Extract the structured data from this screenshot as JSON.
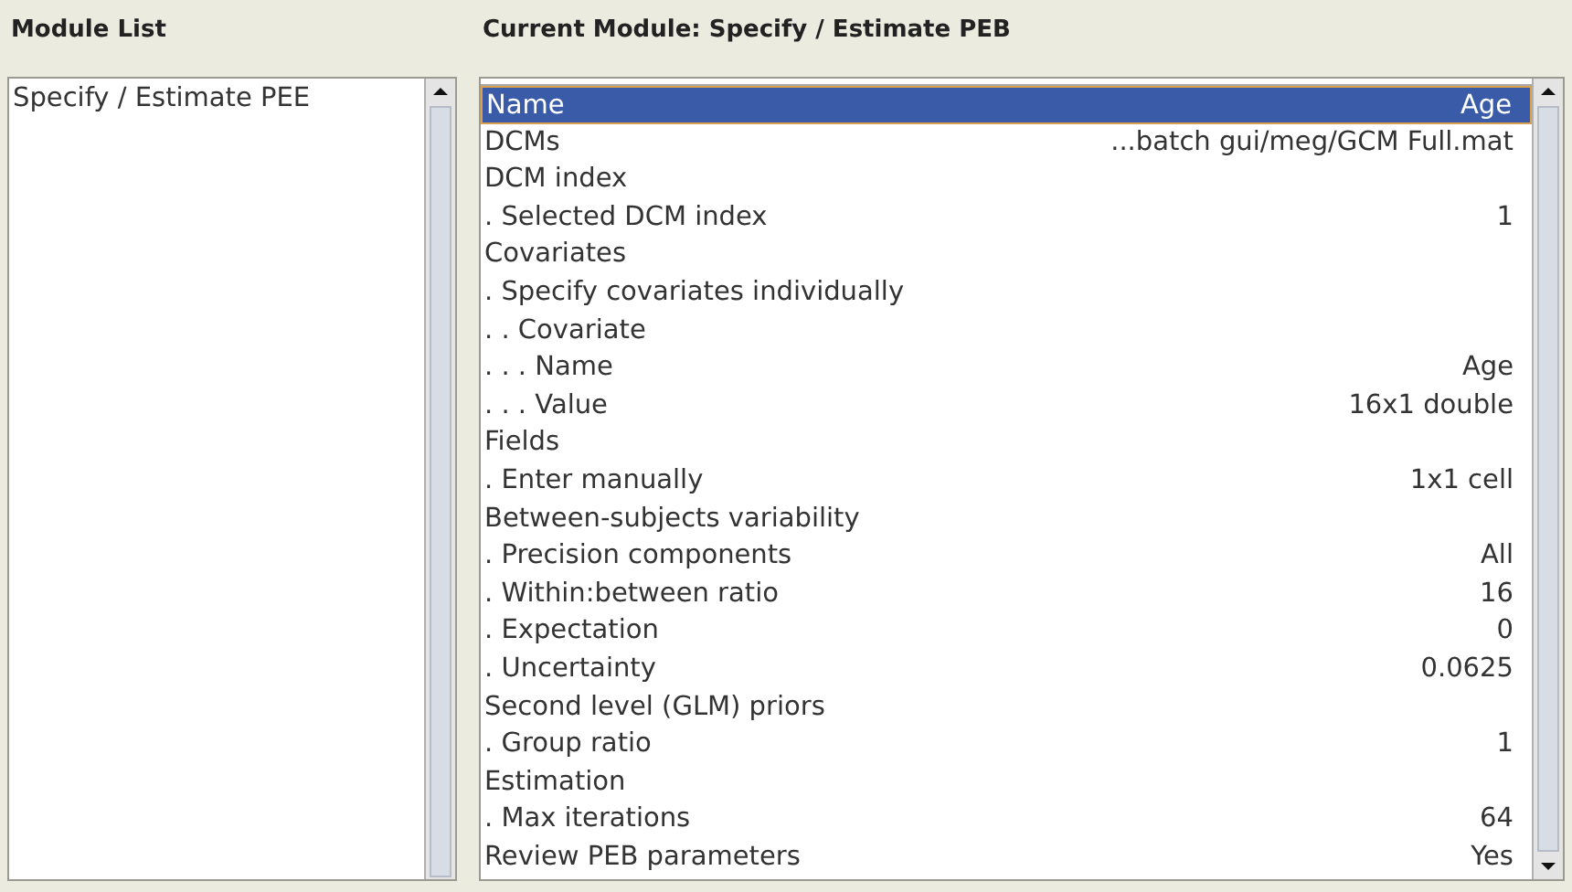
{
  "module_list": {
    "title": "Module List",
    "items": [
      {
        "label": "Specify / Estimate PEE",
        "selected": false
      }
    ]
  },
  "current_module": {
    "title": "Current Module: Specify / Estimate PEB",
    "rows": [
      {
        "label": "Name",
        "value": "Age",
        "selected": true
      },
      {
        "label": "DCMs",
        "value": "...batch  gui/meg/GCM  Full.mat",
        "selected": false
      },
      {
        "label": "DCM index",
        "selected": false
      },
      {
        "label": ". Selected DCM index",
        "value": "1",
        "selected": false
      },
      {
        "label": "Covariates",
        "selected": false
      },
      {
        "label": ". Specify covariates individually",
        "selected": false
      },
      {
        "label": ". . Covariate",
        "selected": false
      },
      {
        "label": ". . . Name",
        "value": "Age",
        "selected": false
      },
      {
        "label": ". . . Value",
        "value": "16x1 double",
        "selected": false
      },
      {
        "label": "Fields",
        "selected": false
      },
      {
        "label": ". Enter manually",
        "value": "1x1 cell",
        "selected": false
      },
      {
        "label": "Between-subjects variability",
        "selected": false
      },
      {
        "label": ". Precision components",
        "value": "All",
        "selected": false
      },
      {
        "label": ". Within:between ratio",
        "value": "16",
        "selected": false
      },
      {
        "label": ". Expectation",
        "value": "0",
        "selected": false
      },
      {
        "label": ". Uncertainty",
        "value": "0.0625",
        "selected": false
      },
      {
        "label": "Second level (GLM) priors",
        "selected": false
      },
      {
        "label": ". Group ratio",
        "value": "1",
        "selected": false
      },
      {
        "label": "Estimation",
        "selected": false
      },
      {
        "label": ". Max iterations",
        "value": "64",
        "selected": false
      },
      {
        "label": "Review PEB parameters",
        "value": "Yes",
        "selected": false
      }
    ]
  }
}
